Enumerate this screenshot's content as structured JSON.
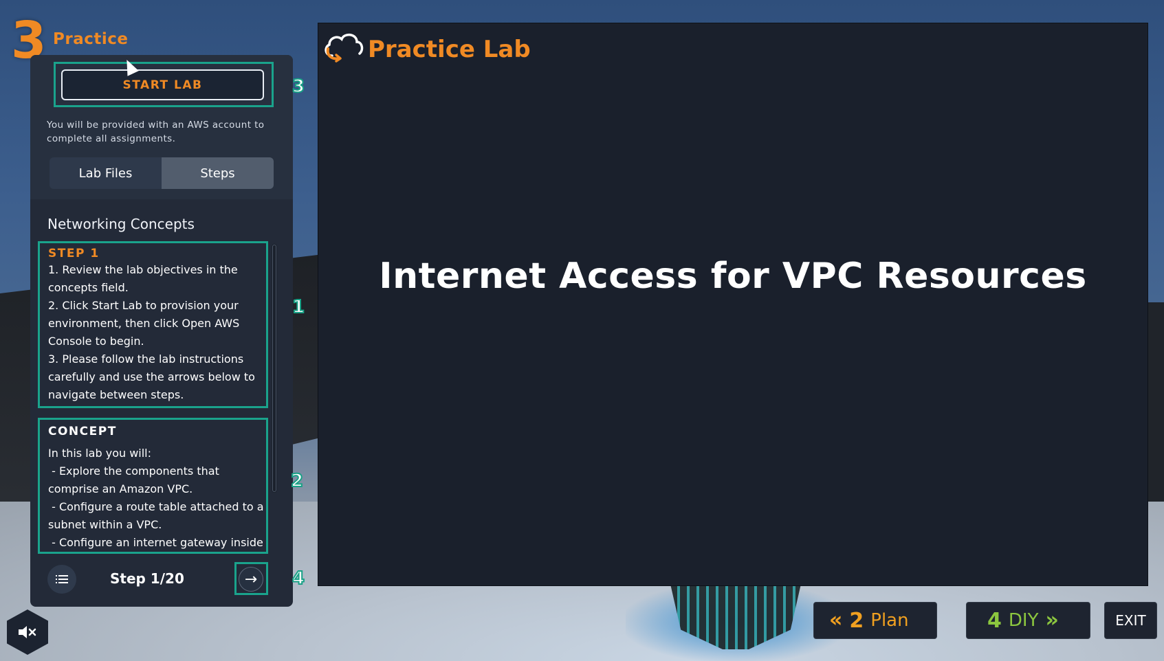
{
  "module": {
    "number": "3",
    "title": "Practice"
  },
  "start_lab": {
    "label": "START LAB"
  },
  "account_note": "You will be provided with an AWS account to complete all assignments.",
  "tabs": [
    {
      "label": "Lab Files"
    },
    {
      "label": "Steps"
    }
  ],
  "section_heading": "Networking Concepts",
  "step": {
    "title": "STEP 1",
    "lines": [
      "1. Review the lab objectives in the",
      "concepts field.",
      "2. Click Start Lab to provision your",
      "environment, then click Open AWS",
      "Console to begin.",
      "3. Please follow the lab instructions",
      "carefully and use the arrows below to",
      "navigate between steps."
    ]
  },
  "concept": {
    "title": "CONCEPT",
    "lines": [
      "In this lab you will:",
      " - Explore the components that",
      "comprise an Amazon VPC.",
      " - Configure a route table attached to a",
      "subnet within a VPC.",
      " - Configure an internet gateway inside"
    ]
  },
  "step_counter": "Step 1/20",
  "callouts": {
    "one": "1",
    "two": "2",
    "three": "3",
    "four": "4"
  },
  "main": {
    "logo_text": "Practice Lab",
    "title": "Internet Access for VPC Resources"
  },
  "nav": {
    "prev": {
      "number": "2",
      "label": "Plan"
    },
    "next": {
      "number": "4",
      "label": "DIY"
    },
    "exit": "EXIT"
  },
  "colors": {
    "accent": "#f08a24",
    "highlight": "#1aa38c",
    "diy": "#8cc63f",
    "plan": "#f0a020"
  },
  "icons": [
    "cursor-icon",
    "list-icon",
    "arrow-right-icon",
    "cloud-refresh-icon",
    "chevrons-left-icon",
    "chevrons-right-icon",
    "sound-muted-icon"
  ]
}
